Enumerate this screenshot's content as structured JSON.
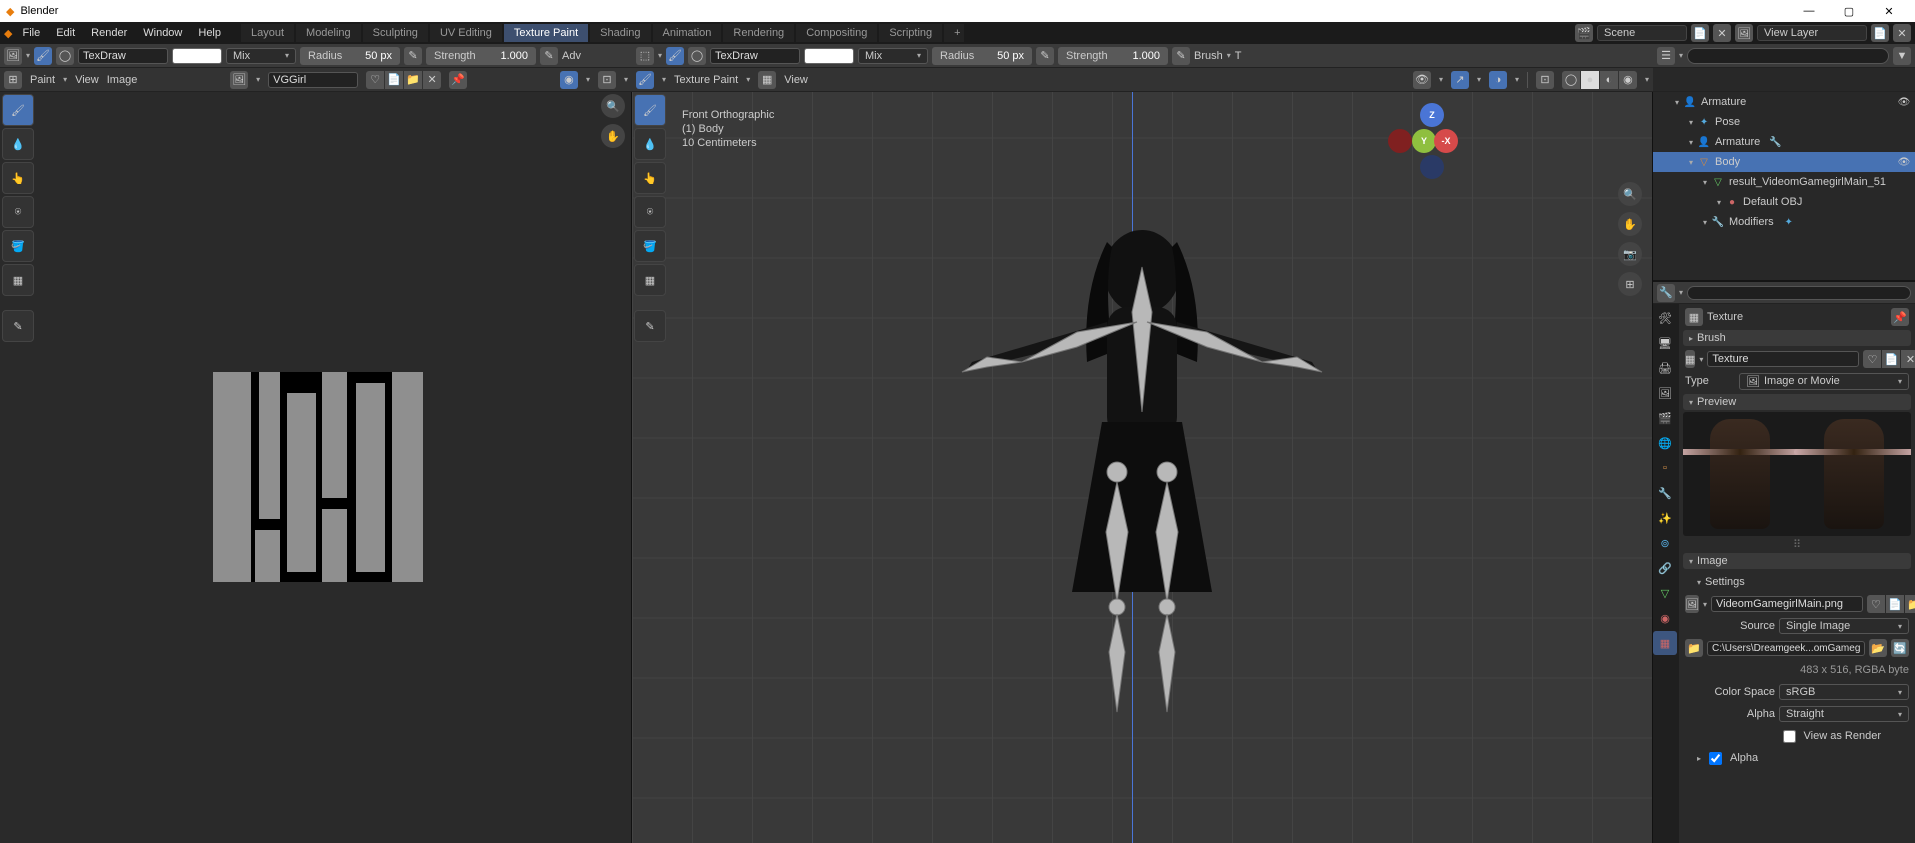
{
  "app": {
    "title": "Blender"
  },
  "window": {
    "min": "—",
    "max": "▢",
    "close": "✕"
  },
  "menubar": [
    "File",
    "Edit",
    "Render",
    "Window",
    "Help"
  ],
  "workspace_tabs": [
    "Layout",
    "Modeling",
    "Sculpting",
    "UV Editing",
    "Texture Paint",
    "Shading",
    "Animation",
    "Rendering",
    "Compositing",
    "Scripting"
  ],
  "workspace_active": "Texture Paint",
  "scene": {
    "label": "Scene",
    "viewlayer": "View Layer"
  },
  "image_header": {
    "mode": "Paint",
    "view": "View",
    "image": "Image",
    "brush_name": "TexDraw",
    "blend": "Mix",
    "radius_label": "Radius",
    "radius_val": "50 px",
    "strength_label": "Strength",
    "strength_val": "1.000",
    "adv": "Adv",
    "image_name": "VGGirl"
  },
  "view_header": {
    "mode": "Texture Paint",
    "view": "View",
    "brush_name": "TexDraw",
    "blend": "Mix",
    "radius_label": "Radius",
    "radius_val": "50 px",
    "strength_label": "Strength",
    "strength_val": "1.000",
    "brush": "Brush",
    "t": "T"
  },
  "overlay": {
    "l1": "Front Orthographic",
    "l2": "(1) Body",
    "l3": "10 Centimeters"
  },
  "gizmo": {
    "z": "Z",
    "y": "Y",
    "x": "-X"
  },
  "outliner": {
    "search": "",
    "items": [
      {
        "depth": 1,
        "icon": "👤",
        "color": "#d88b3e",
        "label": "Armature",
        "selected": false,
        "eye": true
      },
      {
        "depth": 2,
        "icon": "✦",
        "color": "#5ad",
        "label": "Pose",
        "selected": false,
        "eye": false
      },
      {
        "depth": 2,
        "icon": "👤",
        "color": "#5ad",
        "label": "Armature",
        "selected": false,
        "eye": false,
        "extra": "🔧"
      },
      {
        "depth": 2,
        "icon": "▽",
        "color": "#d88b3e",
        "label": "Body",
        "selected": true,
        "eye": true
      },
      {
        "depth": 3,
        "icon": "▽",
        "color": "#6c6",
        "label": "result_VideomGamegirlMain_51",
        "selected": false,
        "eye": false
      },
      {
        "depth": 4,
        "icon": "●",
        "color": "#c66",
        "label": "Default OBJ",
        "selected": false,
        "eye": false
      },
      {
        "depth": 3,
        "icon": "🔧",
        "color": "#8ad",
        "label": "Modifiers",
        "selected": false,
        "eye": false,
        "extra": "✦"
      }
    ]
  },
  "props": {
    "texture_panel": "Texture",
    "brush_panel": "Brush",
    "texture_field": "Texture",
    "type_label": "Type",
    "type_value": "Image or Movie",
    "preview": "Preview",
    "image_panel": "Image",
    "settings": "Settings",
    "image_name": "VideomGamegirlMain.png",
    "source_label": "Source",
    "source_value": "Single Image",
    "file_path": "C:\\Users\\Dreamgeek...omGamegirlMain.png",
    "dims": "483 x 516,  RGBA byte",
    "colorspace_label": "Color Space",
    "colorspace_value": "sRGB",
    "alpha_label": "Alpha",
    "alpha_value": "Straight",
    "view_as_render": "View as Render",
    "alpha_sub": "Alpha"
  }
}
